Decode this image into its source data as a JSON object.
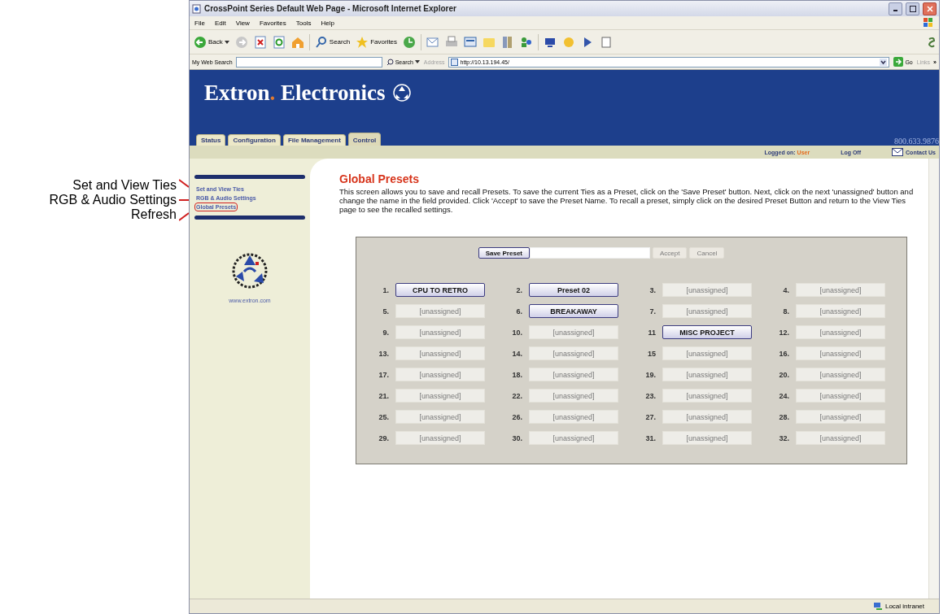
{
  "callouts": [
    "Set and View Ties",
    "RGB & Audio Settings",
    "Refresh"
  ],
  "window": {
    "title": "CrossPoint Series Default Web Page - Microsoft Internet Explorer"
  },
  "menu": [
    "File",
    "Edit",
    "View",
    "Favorites",
    "Tools",
    "Help"
  ],
  "toolbar": {
    "back": "Back",
    "search": "Search",
    "favorites": "Favorites"
  },
  "address_bar": {
    "search_label": "My Web Search",
    "search_button": "Search",
    "address_label": "Address",
    "url": "http://10.13.194.45/",
    "go": "Go",
    "links": "Links",
    "more": "»"
  },
  "header": {
    "brand": "Extron",
    "dot": ".",
    "brand2": "Electronics",
    "phone": "800.633.9876"
  },
  "tabs": [
    {
      "label": "Status",
      "selected": false
    },
    {
      "label": "Configuration",
      "selected": false
    },
    {
      "label": "File Management",
      "selected": false
    },
    {
      "label": "Control",
      "selected": true
    }
  ],
  "user_bar": {
    "logged_on_label": "Logged on:",
    "user": "User",
    "log_off": "Log Off",
    "contact": "Contact Us"
  },
  "sidebar": {
    "links": [
      {
        "label": "Set and View Ties",
        "circled": false
      },
      {
        "label": "RGB & Audio Settings",
        "circled": false
      },
      {
        "label": "Global Presets",
        "circled": true
      }
    ],
    "website": "www.extron.com"
  },
  "main": {
    "title": "Global Presets",
    "description": "This screen allows you to save and recall Presets. To save the current Ties as a Preset, click on the 'Save Preset' button. Next, click on the next 'unassigned' button and change the name in the field provided. Click 'Accept' to save the Preset Name. To recall a preset, simply click on the desired Preset Button and return to the View Ties page to see the recalled settings."
  },
  "preset_panel": {
    "save_button": "Save Preset",
    "accept": {
      "label": "Accept",
      "disabled": true
    },
    "cancel": {
      "label": "Cancel",
      "disabled": true
    }
  },
  "presets": [
    {
      "number": "1.",
      "label": "CPU TO RETRO",
      "assigned": true
    },
    {
      "number": "2.",
      "label": "Preset 02",
      "assigned": true
    },
    {
      "number": "3.",
      "label": "[unassigned]",
      "assigned": false
    },
    {
      "number": "4.",
      "label": "[unassigned]",
      "assigned": false
    },
    {
      "number": "5.",
      "label": "[unassigned]",
      "assigned": false
    },
    {
      "number": "6.",
      "label": "BREAKAWAY",
      "assigned": true
    },
    {
      "number": "7.",
      "label": "[unassigned]",
      "assigned": false
    },
    {
      "number": "8.",
      "label": "[unassigned]",
      "assigned": false
    },
    {
      "number": "9.",
      "label": "[unassigned]",
      "assigned": false
    },
    {
      "number": "10.",
      "label": "[unassigned]",
      "assigned": false
    },
    {
      "number": "11",
      "label": "MISC PROJECT",
      "assigned": true
    },
    {
      "number": "12.",
      "label": "[unassigned]",
      "assigned": false
    },
    {
      "number": "13.",
      "label": "[unassigned]",
      "assigned": false
    },
    {
      "number": "14.",
      "label": "[unassigned]",
      "assigned": false
    },
    {
      "number": "15",
      "label": "[unassigned]",
      "assigned": false
    },
    {
      "number": "16.",
      "label": "[unassigned]",
      "assigned": false
    },
    {
      "number": "17.",
      "label": "[unassigned]",
      "assigned": false
    },
    {
      "number": "18.",
      "label": "[unassigned]",
      "assigned": false
    },
    {
      "number": "19.",
      "label": "[unassigned]",
      "assigned": false
    },
    {
      "number": "20.",
      "label": "[unassigned]",
      "assigned": false
    },
    {
      "number": "21.",
      "label": "[unassigned]",
      "assigned": false
    },
    {
      "number": "22.",
      "label": "[unassigned]",
      "assigned": false
    },
    {
      "number": "23.",
      "label": "[unassigned]",
      "assigned": false
    },
    {
      "number": "24.",
      "label": "[unassigned]",
      "assigned": false
    },
    {
      "number": "25.",
      "label": "[unassigned]",
      "assigned": false
    },
    {
      "number": "26.",
      "label": "[unassigned]",
      "assigned": false
    },
    {
      "number": "27.",
      "label": "[unassigned]",
      "assigned": false
    },
    {
      "number": "28.",
      "label": "[unassigned]",
      "assigned": false
    },
    {
      "number": "29.",
      "label": "[unassigned]",
      "assigned": false
    },
    {
      "number": "30.",
      "label": "[unassigned]",
      "assigned": false
    },
    {
      "number": "31.",
      "label": "[unassigned]",
      "assigned": false
    },
    {
      "number": "32.",
      "label": "[unassigned]",
      "assigned": false
    }
  ],
  "status_bar": {
    "zone": "Local intranet"
  }
}
